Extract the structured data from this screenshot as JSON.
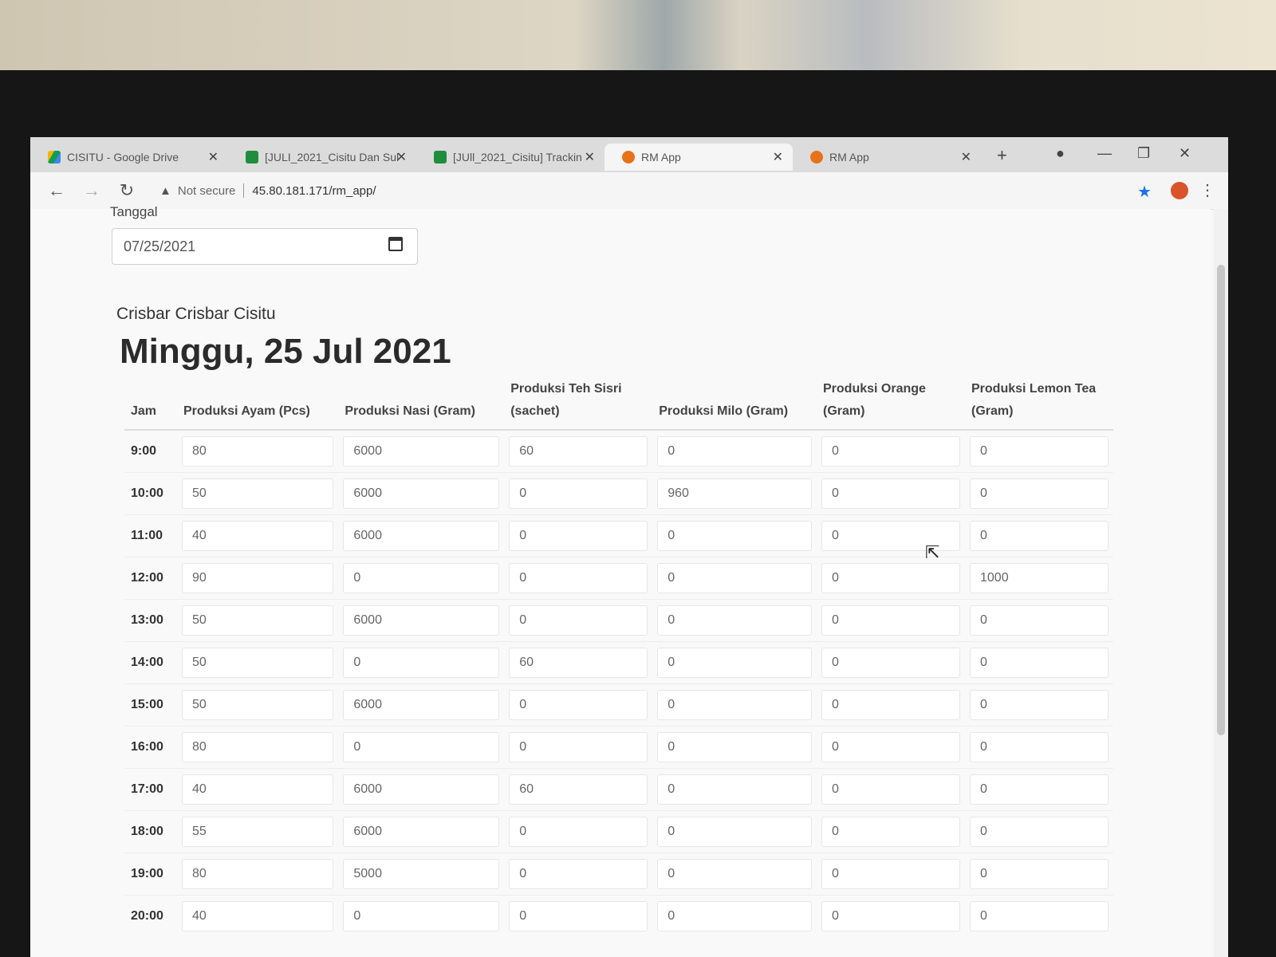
{
  "tabs": [
    {
      "label": "CISITU - Google Drive",
      "icon": "drive-icon"
    },
    {
      "label": "[JULI_2021_Cisitu Dan Sul",
      "icon": "sheets-icon"
    },
    {
      "label": "[JUll_2021_Cisitu] Trackin",
      "icon": "sheets-icon"
    },
    {
      "label": "RM App",
      "icon": "rm-app-icon"
    },
    {
      "label": "RM App",
      "icon": "rm-app-icon"
    }
  ],
  "toolbar": {
    "not_secure": "Not secure",
    "url": "45.80.181.171/rm_app/"
  },
  "form": {
    "date_label": "Tanggal",
    "date_value": "07/25/2021"
  },
  "outlet_name": "Crisbar Crisbar Cisitu",
  "day_heading": "Minggu, 25 Jul 2021",
  "table": {
    "headers": [
      "Jam",
      "Produksi Ayam (Pcs)",
      "Produksi Nasi (Gram)",
      "Produksi Teh Sisri (sachet)",
      "Produksi Milo (Gram)",
      "Produksi Orange (Gram)",
      "Produksi Lemon Tea (Gram)"
    ],
    "rows": [
      {
        "jam": "9:00",
        "values": [
          "80",
          "6000",
          "60",
          "0",
          "0",
          "0"
        ]
      },
      {
        "jam": "10:00",
        "values": [
          "50",
          "6000",
          "0",
          "960",
          "0",
          "0"
        ]
      },
      {
        "jam": "11:00",
        "values": [
          "40",
          "6000",
          "0",
          "0",
          "0",
          "0"
        ]
      },
      {
        "jam": "12:00",
        "values": [
          "90",
          "0",
          "0",
          "0",
          "0",
          "1000"
        ]
      },
      {
        "jam": "13:00",
        "values": [
          "50",
          "6000",
          "0",
          "0",
          "0",
          "0"
        ]
      },
      {
        "jam": "14:00",
        "values": [
          "50",
          "0",
          "60",
          "0",
          "0",
          "0"
        ]
      },
      {
        "jam": "15:00",
        "values": [
          "50",
          "6000",
          "0",
          "0",
          "0",
          "0"
        ]
      },
      {
        "jam": "16:00",
        "values": [
          "80",
          "0",
          "0",
          "0",
          "0",
          "0"
        ]
      },
      {
        "jam": "17:00",
        "values": [
          "40",
          "6000",
          "60",
          "0",
          "0",
          "0"
        ]
      },
      {
        "jam": "18:00",
        "values": [
          "55",
          "6000",
          "0",
          "0",
          "0",
          "0"
        ]
      },
      {
        "jam": "19:00",
        "values": [
          "80",
          "5000",
          "0",
          "0",
          "0",
          "0"
        ]
      },
      {
        "jam": "20:00",
        "values": [
          "40",
          "0",
          "0",
          "0",
          "0",
          "0"
        ]
      }
    ]
  },
  "colors": {
    "bookmark_star": "#1a73e8",
    "sheets_green": "#1e8e3e",
    "rm_app_orange": "#e8711c"
  }
}
